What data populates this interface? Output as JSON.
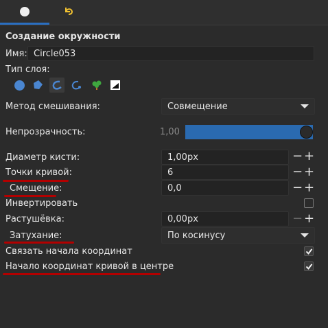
{
  "tabs": [
    {
      "icon": "circle-icon"
    },
    {
      "icon": "undo-arrow-icon"
    }
  ],
  "section_title": "Создание окружности",
  "name": {
    "label": "Имя:",
    "value": "Circle053"
  },
  "layer_type": {
    "label": "Тип слоя:",
    "icons": [
      "circle-layer-icon",
      "region-layer-icon",
      "outline-layer-icon",
      "advanced-outline-layer-icon",
      "plant-layer-icon",
      "curve-gradient-layer-icon"
    ]
  },
  "blend_method": {
    "label": "Метод смешивания:",
    "value": "Совмещение"
  },
  "opacity": {
    "label": "Непрозрачность:",
    "value": "1,00",
    "fraction": 1.0,
    "fill_color": "#2a6ab0"
  },
  "brush_size": {
    "label": "Диаметр кисти:",
    "value": "1,00px"
  },
  "curve_points": {
    "label": "Точки кривой:",
    "value": "6"
  },
  "offset": {
    "label": "Смещение:",
    "value": "0,0"
  },
  "invert": {
    "label": "Инвертировать",
    "checked": false
  },
  "feather": {
    "label": "Растушёвка:",
    "value": "0,00px"
  },
  "falloff": {
    "label": "Затухание:",
    "value": "По косинусу"
  },
  "link_origins": {
    "label": "Связать начала координат",
    "checked": true
  },
  "curve_origin_center": {
    "label": "Начало координат кривой в центре",
    "checked": true
  },
  "annotation_color": "#b30000",
  "accent_color": "#2a6fc2"
}
